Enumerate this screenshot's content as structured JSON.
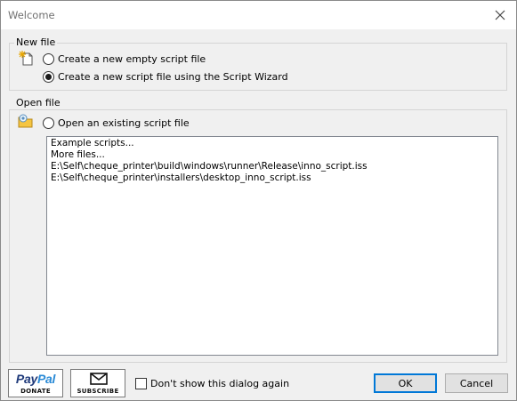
{
  "window": {
    "title": "Welcome"
  },
  "new_file": {
    "legend": "New file",
    "option_empty": "Create a new empty script file",
    "option_wizard": "Create a new script file using the Script Wizard",
    "selected": "wizard"
  },
  "open_file": {
    "legend": "Open file",
    "option_existing": "Open an existing script file",
    "items": [
      "Example scripts...",
      "More files...",
      "E:\\Self\\cheque_printer\\build\\windows\\runner\\Release\\inno_script.iss",
      "E:\\Self\\cheque_printer\\installers\\desktop_inno_script.iss"
    ]
  },
  "footer": {
    "paypal_pay": "Pay",
    "paypal_pal": "Pal",
    "donate_label": "DONATE",
    "subscribe_label": "SUBSCRIBE",
    "dont_show_label": "Don't show this dialog again",
    "ok_label": "OK",
    "cancel_label": "Cancel"
  }
}
